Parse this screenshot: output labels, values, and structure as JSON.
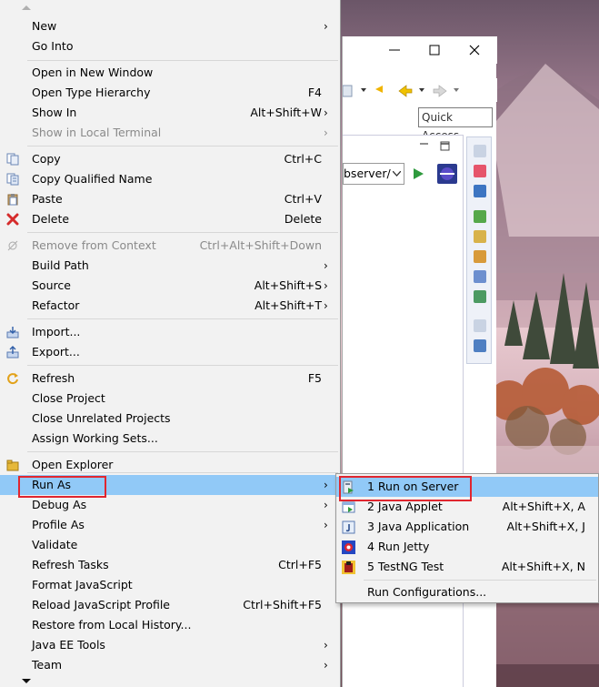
{
  "eclipse_window": {
    "url_partial": "bserver/",
    "quick_access_label": "Quick Access"
  },
  "context_menu": {
    "items": [
      {
        "label": "New",
        "shortcut": "",
        "submenu": true,
        "disabled": false,
        "icon": ""
      },
      {
        "label": "Go Into",
        "shortcut": "",
        "submenu": false,
        "disabled": false,
        "icon": ""
      },
      {
        "label": "Open in New Window",
        "shortcut": "",
        "submenu": false,
        "disabled": false,
        "icon": ""
      },
      {
        "label": "Open Type Hierarchy",
        "shortcut": "F4",
        "submenu": false,
        "disabled": false,
        "icon": ""
      },
      {
        "label": "Show In",
        "shortcut": "Alt+Shift+W",
        "submenu": true,
        "disabled": false,
        "icon": ""
      },
      {
        "label": "Show in Local Terminal",
        "shortcut": "",
        "submenu": true,
        "disabled": true,
        "icon": ""
      },
      {
        "label": "Copy",
        "shortcut": "Ctrl+C",
        "submenu": false,
        "disabled": false,
        "icon": "copy-icon"
      },
      {
        "label": "Copy Qualified Name",
        "shortcut": "",
        "submenu": false,
        "disabled": false,
        "icon": "copy-qualified-icon"
      },
      {
        "label": "Paste",
        "shortcut": "Ctrl+V",
        "submenu": false,
        "disabled": false,
        "icon": "paste-icon"
      },
      {
        "label": "Delete",
        "shortcut": "Delete",
        "submenu": false,
        "disabled": false,
        "icon": "delete-icon"
      },
      {
        "label": "Remove from Context",
        "shortcut": "Ctrl+Alt+Shift+Down",
        "submenu": false,
        "disabled": true,
        "icon": "remove-context-icon"
      },
      {
        "label": "Build Path",
        "shortcut": "",
        "submenu": true,
        "disabled": false,
        "icon": ""
      },
      {
        "label": "Source",
        "shortcut": "Alt+Shift+S",
        "submenu": true,
        "disabled": false,
        "icon": ""
      },
      {
        "label": "Refactor",
        "shortcut": "Alt+Shift+T",
        "submenu": true,
        "disabled": false,
        "icon": ""
      },
      {
        "label": "Import...",
        "shortcut": "",
        "submenu": false,
        "disabled": false,
        "icon": "import-icon"
      },
      {
        "label": "Export...",
        "shortcut": "",
        "submenu": false,
        "disabled": false,
        "icon": "export-icon"
      },
      {
        "label": "Refresh",
        "shortcut": "F5",
        "submenu": false,
        "disabled": false,
        "icon": "refresh-icon"
      },
      {
        "label": "Close Project",
        "shortcut": "",
        "submenu": false,
        "disabled": false,
        "icon": ""
      },
      {
        "label": "Close Unrelated Projects",
        "shortcut": "",
        "submenu": false,
        "disabled": false,
        "icon": ""
      },
      {
        "label": "Assign Working Sets...",
        "shortcut": "",
        "submenu": false,
        "disabled": false,
        "icon": ""
      },
      {
        "label": "Open Explorer",
        "shortcut": "",
        "submenu": false,
        "disabled": false,
        "icon": "open-explorer-icon"
      },
      {
        "label": "Run As",
        "shortcut": "",
        "submenu": true,
        "disabled": false,
        "icon": ""
      },
      {
        "label": "Debug As",
        "shortcut": "",
        "submenu": true,
        "disabled": false,
        "icon": ""
      },
      {
        "label": "Profile As",
        "shortcut": "",
        "submenu": true,
        "disabled": false,
        "icon": ""
      },
      {
        "label": "Validate",
        "shortcut": "",
        "submenu": false,
        "disabled": false,
        "icon": ""
      },
      {
        "label": "Refresh Tasks",
        "shortcut": "Ctrl+F5",
        "submenu": false,
        "disabled": false,
        "icon": ""
      },
      {
        "label": "Format JavaScript",
        "shortcut": "",
        "submenu": false,
        "disabled": false,
        "icon": ""
      },
      {
        "label": "Reload JavaScript Profile",
        "shortcut": "Ctrl+Shift+F5",
        "submenu": false,
        "disabled": false,
        "icon": ""
      },
      {
        "label": "Restore from Local History...",
        "shortcut": "",
        "submenu": false,
        "disabled": false,
        "icon": ""
      },
      {
        "label": "Java EE Tools",
        "shortcut": "",
        "submenu": true,
        "disabled": false,
        "icon": ""
      },
      {
        "label": "Team",
        "shortcut": "",
        "submenu": true,
        "disabled": false,
        "icon": ""
      }
    ]
  },
  "run_as_submenu": {
    "items": [
      {
        "label": "1 Run on Server",
        "shortcut": "",
        "icon": "run-on-server-icon"
      },
      {
        "label": "2 Java Applet",
        "shortcut": "Alt+Shift+X, A",
        "icon": "java-applet-icon"
      },
      {
        "label": "3 Java Application",
        "shortcut": "Alt+Shift+X, J",
        "icon": "java-application-icon"
      },
      {
        "label": "4 Run Jetty",
        "shortcut": "",
        "icon": "run-jetty-icon"
      },
      {
        "label": "5 TestNG Test",
        "shortcut": "Alt+Shift+X, N",
        "icon": "testng-icon"
      },
      {
        "label": "Run Configurations...",
        "shortcut": "",
        "icon": ""
      }
    ]
  },
  "colors": {
    "menu_bg": "#f2f2f2",
    "highlight": "#91c9f7",
    "callout_red": "#e0262f",
    "disabled_text": "#8a8a8a"
  }
}
